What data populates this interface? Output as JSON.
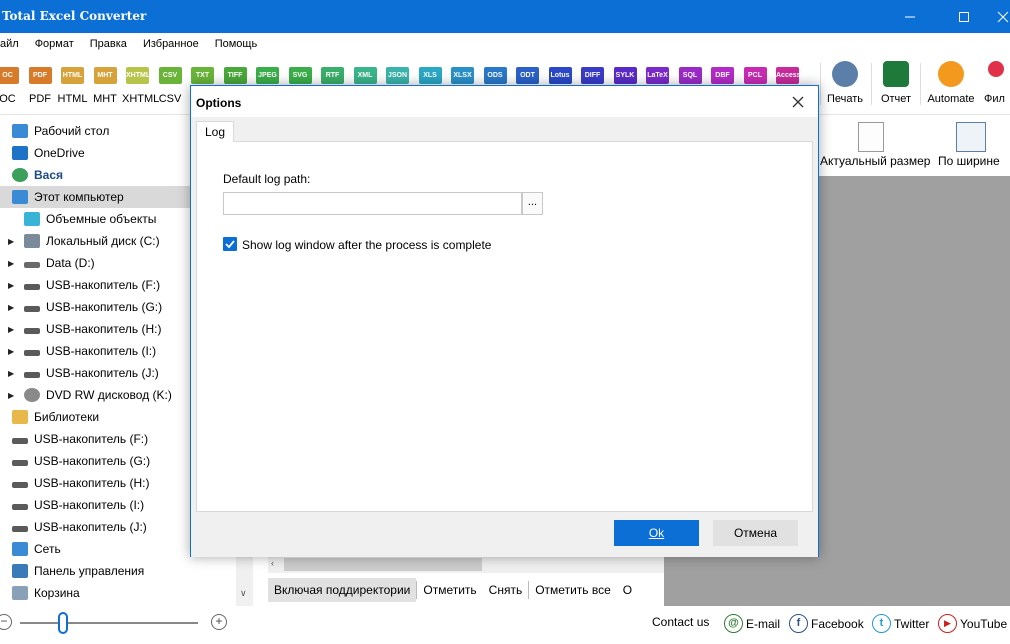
{
  "app": {
    "title": "Total Excel Converter"
  },
  "menu": [
    "айл",
    "Формат",
    "Правка",
    "Избранное",
    "Помощь"
  ],
  "formats": [
    {
      "icon": "OC",
      "label": "OC",
      "color": "#d77a2a"
    },
    {
      "icon": "PDF",
      "label": "PDF",
      "color": "#d77a2a"
    },
    {
      "icon": "HTML",
      "label": "HTML",
      "color": "#d7a23a"
    },
    {
      "icon": "MHT",
      "label": "MHT",
      "color": "#d7a23a"
    },
    {
      "icon": "XHTML",
      "label": "XHTML",
      "color": "#b7c44a"
    },
    {
      "icon": "CSV",
      "label": "CSV",
      "color": "#6ab43a"
    },
    {
      "icon": "TXT",
      "label": "",
      "color": "#6ab43a"
    },
    {
      "icon": "TIFF",
      "label": "",
      "color": "#4aa83a"
    },
    {
      "icon": "JPEG",
      "label": "",
      "color": "#3aae4a"
    },
    {
      "icon": "SVG",
      "label": "",
      "color": "#3aae4a"
    },
    {
      "icon": "RTF",
      "label": "",
      "color": "#3aae6a"
    },
    {
      "icon": "XML",
      "label": "",
      "color": "#3ab48a"
    },
    {
      "icon": "JSON",
      "label": "",
      "color": "#3ab4aa"
    },
    {
      "icon": "XLS",
      "label": "",
      "color": "#2aa8c4"
    },
    {
      "icon": "XLSX",
      "label": "",
      "color": "#2a90c8"
    },
    {
      "icon": "ODS",
      "label": "",
      "color": "#2a78c8"
    },
    {
      "icon": "ODT",
      "label": "",
      "color": "#2a60c8"
    },
    {
      "icon": "Lotus",
      "label": "",
      "color": "#2a48c8"
    },
    {
      "icon": "DIFF",
      "label": "",
      "color": "#3a3ac8"
    },
    {
      "icon": "SYLK",
      "label": "",
      "color": "#5a2ac8"
    },
    {
      "icon": "LaTeX",
      "label": "",
      "color": "#7a2ac8"
    },
    {
      "icon": "SQL",
      "label": "",
      "color": "#9a2ac8"
    },
    {
      "icon": "DBF",
      "label": "",
      "color": "#b42ac8"
    },
    {
      "icon": "PCL",
      "label": "",
      "color": "#c82ab4"
    },
    {
      "icon": "Access",
      "label": "",
      "color": "#c82a9a"
    }
  ],
  "tools": {
    "print": "Печать",
    "report": "Отчет",
    "automate": "Automate",
    "filter": "Фил"
  },
  "tree": [
    {
      "label": "Рабочий стол",
      "icon": "desktop-icon",
      "indent": 0,
      "expander": false,
      "bold": false,
      "sel": false
    },
    {
      "label": "OneDrive",
      "icon": "cloud-icon",
      "indent": 0,
      "expander": false,
      "bold": false,
      "sel": false
    },
    {
      "label": "Вася",
      "icon": "user-icon",
      "indent": 0,
      "expander": false,
      "bold": true,
      "sel": false
    },
    {
      "label": "Этот компьютер",
      "icon": "computer-icon",
      "indent": 0,
      "expander": false,
      "bold": false,
      "sel": true
    },
    {
      "label": "Объемные объекты",
      "icon": "cube-icon",
      "indent": 1,
      "expander": false,
      "bold": false,
      "sel": false
    },
    {
      "label": "Локальный диск (C:)",
      "icon": "windows-drive-icon",
      "indent": 1,
      "expander": true,
      "bold": false,
      "sel": false
    },
    {
      "label": "Data (D:)",
      "icon": "drive-icon",
      "indent": 1,
      "expander": true,
      "bold": false,
      "sel": false
    },
    {
      "label": "USB-накопитель (F:)",
      "icon": "usb-drive-icon",
      "indent": 1,
      "expander": true,
      "bold": false,
      "sel": false
    },
    {
      "label": "USB-накопитель (G:)",
      "icon": "usb-drive-icon",
      "indent": 1,
      "expander": true,
      "bold": false,
      "sel": false
    },
    {
      "label": "USB-накопитель (H:)",
      "icon": "usb-drive-icon",
      "indent": 1,
      "expander": true,
      "bold": false,
      "sel": false
    },
    {
      "label": "USB-накопитель (I:)",
      "icon": "usb-drive-icon",
      "indent": 1,
      "expander": true,
      "bold": false,
      "sel": false
    },
    {
      "label": "USB-накопитель (J:)",
      "icon": "usb-drive-icon",
      "indent": 1,
      "expander": true,
      "bold": false,
      "sel": false
    },
    {
      "label": "DVD RW дисковод (K:)",
      "icon": "dvd-icon",
      "indent": 1,
      "expander": true,
      "bold": false,
      "sel": false
    },
    {
      "label": "Библиотеки",
      "icon": "library-icon",
      "indent": 0,
      "expander": false,
      "bold": false,
      "sel": false
    },
    {
      "label": "USB-накопитель (F:)",
      "icon": "usb-drive-icon",
      "indent": 0,
      "expander": false,
      "bold": false,
      "sel": false
    },
    {
      "label": "USB-накопитель (G:)",
      "icon": "usb-drive-icon",
      "indent": 0,
      "expander": false,
      "bold": false,
      "sel": false
    },
    {
      "label": "USB-накопитель (H:)",
      "icon": "usb-drive-icon",
      "indent": 0,
      "expander": false,
      "bold": false,
      "sel": false
    },
    {
      "label": "USB-накопитель (I:)",
      "icon": "usb-drive-icon",
      "indent": 0,
      "expander": false,
      "bold": false,
      "sel": false
    },
    {
      "label": "USB-накопитель (J:)",
      "icon": "usb-drive-icon",
      "indent": 0,
      "expander": false,
      "bold": false,
      "sel": false
    },
    {
      "label": "Сеть",
      "icon": "network-icon",
      "indent": 0,
      "expander": false,
      "bold": false,
      "sel": false
    },
    {
      "label": "Панель управления",
      "icon": "control-panel-icon",
      "indent": 0,
      "expander": false,
      "bold": false,
      "sel": false
    },
    {
      "label": "Корзина",
      "icon": "recycle-bin-icon",
      "indent": 0,
      "expander": false,
      "bold": false,
      "sel": false
    }
  ],
  "viewer": {
    "actual_size": "Актуальный размер",
    "fit_width": "По ширине"
  },
  "bottom_buttons": {
    "include_subdirs": "Включая поддиректории",
    "check": "Отметить",
    "uncheck": "Снять",
    "check_all": "Отметить все",
    "more": "О"
  },
  "status": {
    "contact": "Contact us",
    "email": "E-mail",
    "facebook": "Facebook",
    "twitter": "Twitter",
    "youtube": "YouTube"
  },
  "dialog": {
    "title": "Options",
    "tab": "Log",
    "path_label": "Default log path:",
    "path_value": "",
    "browse": "...",
    "show_log": "Show log window after the process is complete",
    "show_log_checked": true,
    "ok": "Ok",
    "cancel": "Отмена"
  }
}
